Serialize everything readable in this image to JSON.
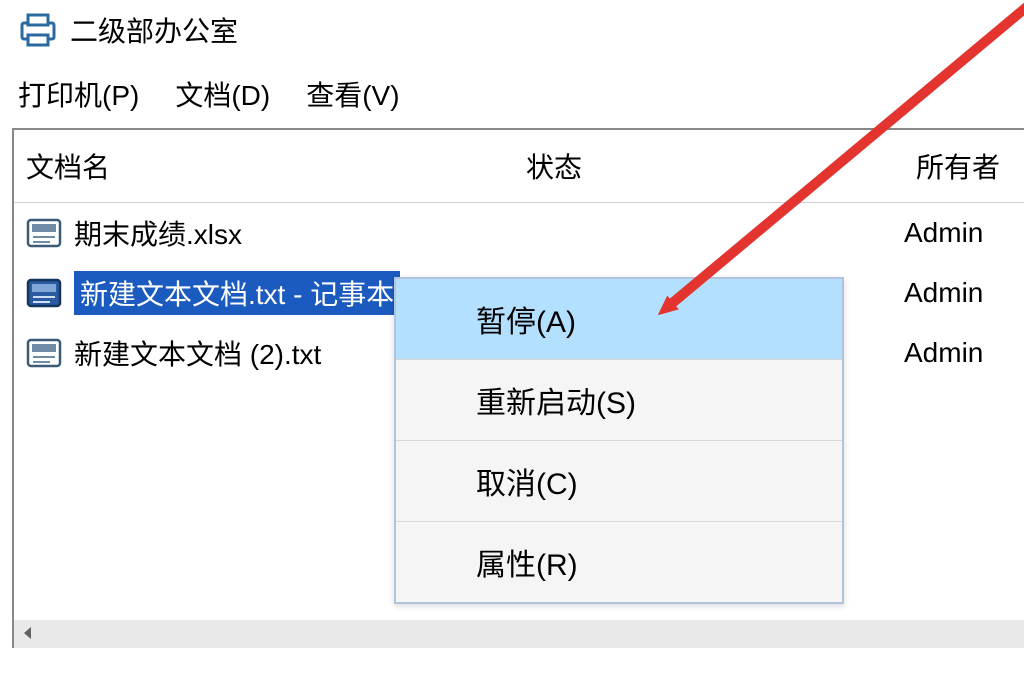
{
  "window": {
    "title": "二级部办公室"
  },
  "menu": {
    "printer": "打印机(P)",
    "document": "文档(D)",
    "view": "查看(V)"
  },
  "columns": {
    "name": "文档名",
    "status": "状态",
    "owner": "所有者"
  },
  "rows": [
    {
      "name": "期末成绩.xlsx",
      "owner": "Admin",
      "selected": false
    },
    {
      "name": "新建文本文档.txt - 记事本",
      "owner": "Admin",
      "selected": true
    },
    {
      "name": "新建文本文档 (2).txt",
      "owner": "Admin",
      "selected": false
    }
  ],
  "context_menu": {
    "pause": "暂停(A)",
    "restart": "重新启动(S)",
    "cancel": "取消(C)",
    "properties": "属性(R)"
  },
  "annotation": {
    "arrow_color": "#e3342f"
  }
}
